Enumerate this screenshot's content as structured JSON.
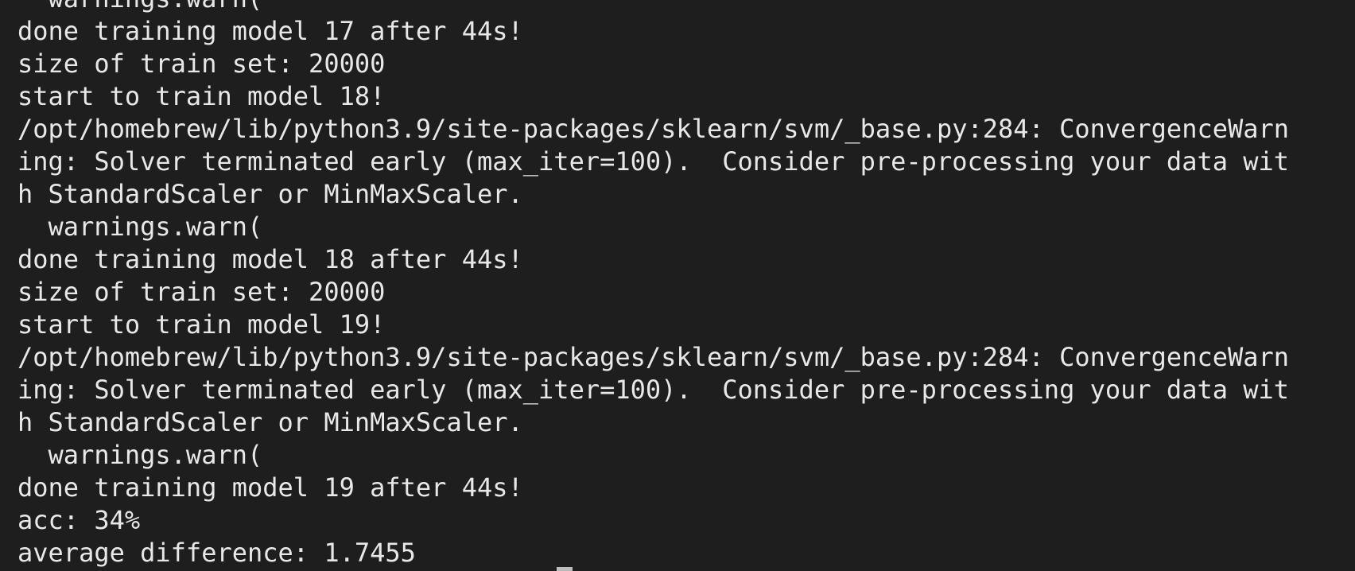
{
  "terminal": {
    "lines": [
      "  warnings.warn(",
      "done training model 17 after 44s!",
      "size of train set: 20000",
      "start to train model 18!",
      "/opt/homebrew/lib/python3.9/site-packages/sklearn/svm/_base.py:284: ConvergenceWarn",
      "ing: Solver terminated early (max_iter=100).  Consider pre-processing your data wit",
      "h StandardScaler or MinMaxScaler.",
      "  warnings.warn(",
      "done training model 18 after 44s!",
      "size of train set: 20000",
      "start to train model 19!",
      "/opt/homebrew/lib/python3.9/site-packages/sklearn/svm/_base.py:284: ConvergenceWarn",
      "ing: Solver terminated early (max_iter=100).  Consider pre-processing your data wit",
      "h StandardScaler or MinMaxScaler.",
      "  warnings.warn(",
      "done training model 19 after 44s!",
      "acc: 34%",
      "average difference: 1.7455"
    ]
  }
}
